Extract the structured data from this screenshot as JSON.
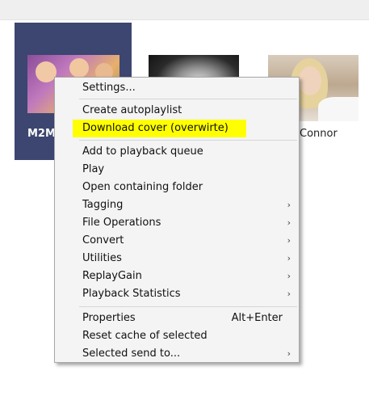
{
  "tiles": [
    {
      "label": "M2M",
      "image": "album-cover-two-girls"
    },
    {
      "label": "",
      "image": "album-cover-bw-portrait"
    },
    {
      "label": "Connor",
      "image": "album-cover-blonde-woman"
    }
  ],
  "menu": {
    "items": [
      {
        "label": "Settings...",
        "arrow": false
      },
      {
        "label": "Create autoplaylist",
        "arrow": false
      },
      {
        "label": "Download cover (overwirte)",
        "arrow": false,
        "highlighted": true
      },
      {
        "label": "Add to playback queue",
        "arrow": false
      },
      {
        "label": "Play",
        "arrow": false
      },
      {
        "label": "Open containing folder",
        "arrow": false
      },
      {
        "label": "Tagging",
        "arrow": true
      },
      {
        "label": "File Operations",
        "arrow": true
      },
      {
        "label": "Convert",
        "arrow": true
      },
      {
        "label": "Utilities",
        "arrow": true
      },
      {
        "label": "ReplayGain",
        "arrow": true
      },
      {
        "label": "Playback Statistics",
        "arrow": true
      },
      {
        "label": "Properties",
        "shortcut": "Alt+Enter",
        "arrow": false
      },
      {
        "label": "Reset cache of selected",
        "arrow": false
      },
      {
        "label": "Selected send to...",
        "arrow": true
      }
    ],
    "submenu_arrow": "›"
  },
  "colors": {
    "selected_tile": "#3c4670",
    "highlight": "#ffff00",
    "menu_bg": "#f4f4f4"
  }
}
